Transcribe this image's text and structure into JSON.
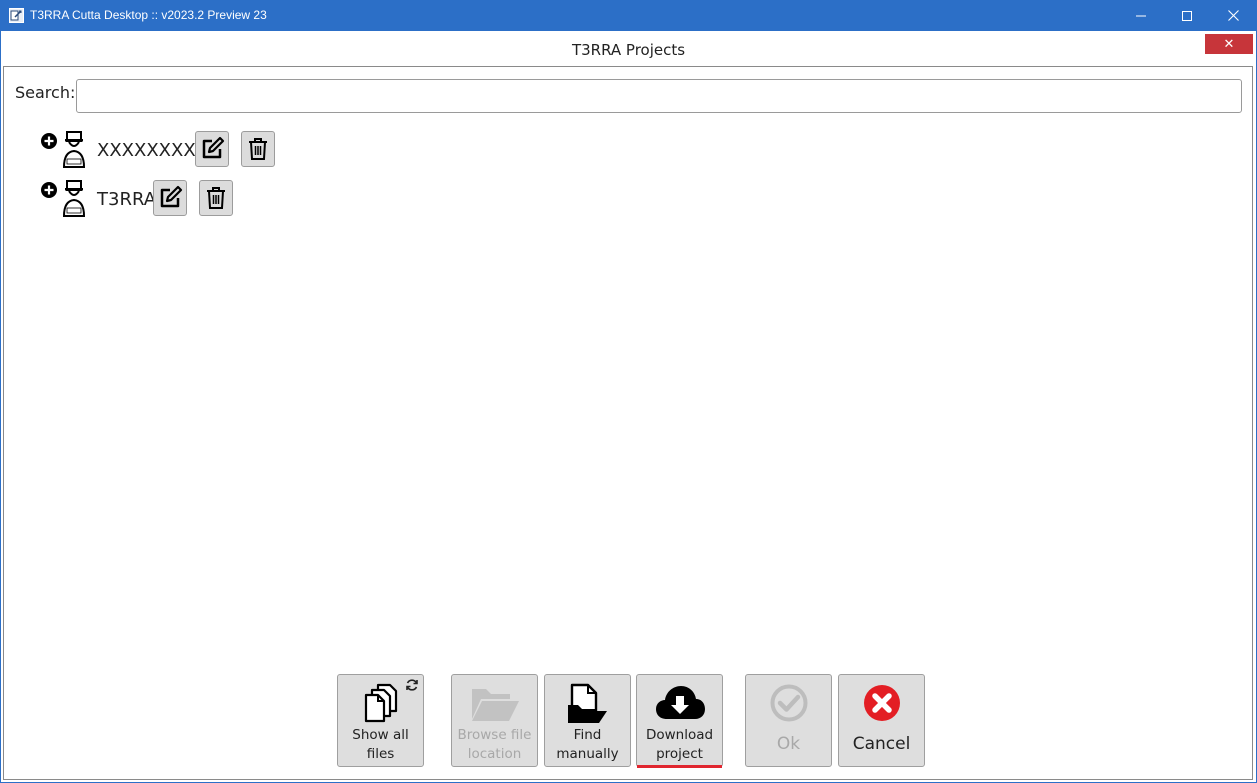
{
  "window": {
    "title": "T3RRA Cutta Desktop :: v2023.2 Preview 23"
  },
  "dialog": {
    "title": "T3RRA Projects",
    "close_glyph": "✕"
  },
  "search": {
    "label": "Search:",
    "value": "",
    "placeholder": ""
  },
  "projects": [
    {
      "name": "XXXXXXXXX"
    },
    {
      "name": "T3RRA"
    }
  ],
  "buttons": {
    "show_all_files": {
      "line1": "Show all",
      "line2": "files",
      "enabled": true
    },
    "browse_file_location": {
      "line1": "Browse file",
      "line2": "location",
      "enabled": false
    },
    "find_manually": {
      "line1": "Find",
      "line2": "manually",
      "enabled": true
    },
    "download_project": {
      "line1": "Download",
      "line2": "project",
      "enabled": true,
      "focused": true
    },
    "ok": {
      "label": "Ok",
      "enabled": false
    },
    "cancel": {
      "label": "Cancel",
      "enabled": true
    }
  },
  "colors": {
    "titlebar": "#2c6fc7",
    "dialog_close": "#c7353a",
    "cancel_icon": "#e31e24",
    "focus_underline": "#e0262f"
  }
}
